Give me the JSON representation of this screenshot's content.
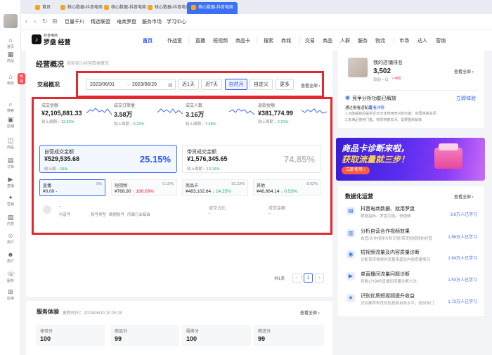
{
  "sidebar": {
    "items": [
      {
        "label": "首页",
        "icon": "home-icon"
      },
      {
        "label": "商品",
        "icon": "goods-icon"
      },
      {
        "label": "电商",
        "icon": "store-icon"
      },
      {
        "label": "搜索",
        "icon": "search-icon"
      },
      {
        "label": "店铺",
        "icon": "shop-icon"
      },
      {
        "label": "商品",
        "icon": "box-icon"
      },
      {
        "label": "订单",
        "icon": "order-icon"
      },
      {
        "label": "直播",
        "icon": "live-icon"
      },
      {
        "label": "营销",
        "icon": "marketing-icon"
      },
      {
        "label": "内容",
        "icon": "content-icon"
      },
      {
        "label": "用户",
        "icon": "user-icon"
      },
      {
        "label": "用户",
        "icon": "users-icon"
      },
      {
        "label": "服务",
        "icon": "service-icon"
      },
      {
        "label": "应用",
        "icon": "app-icon"
      }
    ],
    "hot_badge": "热销"
  },
  "browser_tabs": [
    {
      "label": "首页"
    },
    {
      "label": "核心数据-抖音电商"
    },
    {
      "label": "核心数据-抖音电商"
    },
    {
      "label": "核心数据-抖音电商"
    },
    {
      "label": "核心数据-抖音电商"
    }
  ],
  "toolbar": {
    "links": [
      "巨量千川",
      "精选联盟",
      "电商罗盘",
      "服务市场",
      "学习中心"
    ]
  },
  "header": {
    "logo_small": "抖音电商",
    "logo_title": "罗盘 经营",
    "nav": [
      "首页",
      "作战室",
      "直播",
      "短视频",
      "商品卡",
      "搜索",
      "商城",
      "交易",
      "商品",
      "人群",
      "服务",
      "物流",
      "市场",
      "达人",
      "营销"
    ]
  },
  "main": {
    "title": "经营概况",
    "subtitle": "商家核心经营数据概览",
    "trade_label": "交易概况",
    "date_start": "2023/06/01",
    "date_sep": "→",
    "date_end": "2023/06/29",
    "range_chips": [
      "近1天",
      "近7天",
      "自然月",
      "自定义",
      "更多"
    ],
    "view_all": "查看全部",
    "metrics": [
      {
        "name": "成交金额",
        "value": "¥2,105,881.33",
        "compare": "较上周期",
        "change": "↓ 13.63%"
      },
      {
        "name": "成交订单量",
        "value": "3.58万",
        "compare": "较上周期",
        "change": "↓ 6.22%"
      },
      {
        "name": "成交人数",
        "value": "3.16万",
        "compare": "较上周期",
        "change": "↓ 7.48%"
      },
      {
        "name": "退款金额",
        "value": "¥381,774.99",
        "compare": "较上周期",
        "change": "↓ 2.21%"
      }
    ],
    "self_card": {
      "title": "自营成交金额",
      "value": "¥529,535.68",
      "compare": "较上周",
      "change": "↓ 15%",
      "pct": "25.15%"
    },
    "affiliate_card": {
      "title": "带货成交金额",
      "value": "¥1,576,345.65",
      "compare": "较上周期",
      "change": "↓ 13.16%",
      "pct": "74.85%"
    },
    "channels": [
      {
        "name": "直播",
        "pct": "0%",
        "value": "¥0.00",
        "change": "-",
        "trend": "neutral"
      },
      {
        "name": "短视频",
        "pct": "0.15%",
        "value": "¥768.90",
        "change": "↑ 186.09%",
        "trend": "up"
      },
      {
        "name": "商品卡",
        "pct": "91.23%",
        "value": "¥483,102.64",
        "change": "↓ 14.25%",
        "trend": "down"
      },
      {
        "name": "其他",
        "pct": "8.62%",
        "value": "¥46,664.14",
        "change": "↓ 0.53%",
        "trend": "down"
      }
    ],
    "author_row": {
      "name": "-",
      "id_label": "抖音号",
      "type_label": "账号类型",
      "data_label": "数据账号",
      "industry_label": "所属行业",
      "industry_value": "综合",
      "ratio_label": "成交占比",
      "ratio_value": "-",
      "amount_label": "成交金额",
      "amount_value": "-"
    },
    "pagination": {
      "total": "共1条",
      "prev": "‹",
      "page": "1",
      "next": "›"
    }
  },
  "service": {
    "title": "服务体验",
    "updated": "更新时间：2023/06/30 10:25:30",
    "view_all": "查看全部",
    "scores": [
      {
        "label": "体验分",
        "value": "100"
      },
      {
        "label": "商品分",
        "value": "99"
      },
      {
        "label": "服务分",
        "value": "100"
      },
      {
        "label": "物流分",
        "value": "99"
      }
    ]
  },
  "right": {
    "store_rank_label": "我的店铺排名",
    "store_rank_value": "3,502",
    "rank_change_prefix": "较前一日",
    "rank_change": "↑ 456",
    "view_all": "查看全部",
    "notice_title": "竞争分析功能已解放",
    "notice_link": "立即体验",
    "notice_sub_title": "通过看看适配后",
    "notice_sub_link": "查看详情",
    "notice_lines": [
      "1.功能解锁后提供近30天未使用竞对的功能、权限将被关闭",
      "2.未满足使用门槛、权限将被关闭，需要重新解锁"
    ],
    "banner_line1": "商品卡诊断来啦，",
    "banner_line2": "获取流量就三步！",
    "banner_button": "立即使用"
  },
  "ops": {
    "title": "数据化运营",
    "view_all": "查看全部",
    "courses": [
      {
        "title": "抖音电商数据、就用罗盘",
        "desc": "数据指标、罗盘功能，快速破",
        "count": "3.6万人已学习"
      },
      {
        "title": "分析自营合作视频效果",
        "desc": "自营/合作视频分析识别/带货短视频的经营",
        "count": "1.86万人已学习"
      },
      {
        "title": "短视频流量及内容质量诊断",
        "desc": "诊断带货视频的流量来源及内容质量情况",
        "count": "1.94万人已学习"
      },
      {
        "title": "单直播间流量问题诊断",
        "desc": "到看1分钟的直播间流量诊断方法",
        "count": "1.53万人已学习"
      },
      {
        "title": "识别优质短视频提升收益",
        "desc": "识别推荐带货的短视频自身水平，提供热门",
        "count": "1.73万人已学习"
      }
    ]
  }
}
